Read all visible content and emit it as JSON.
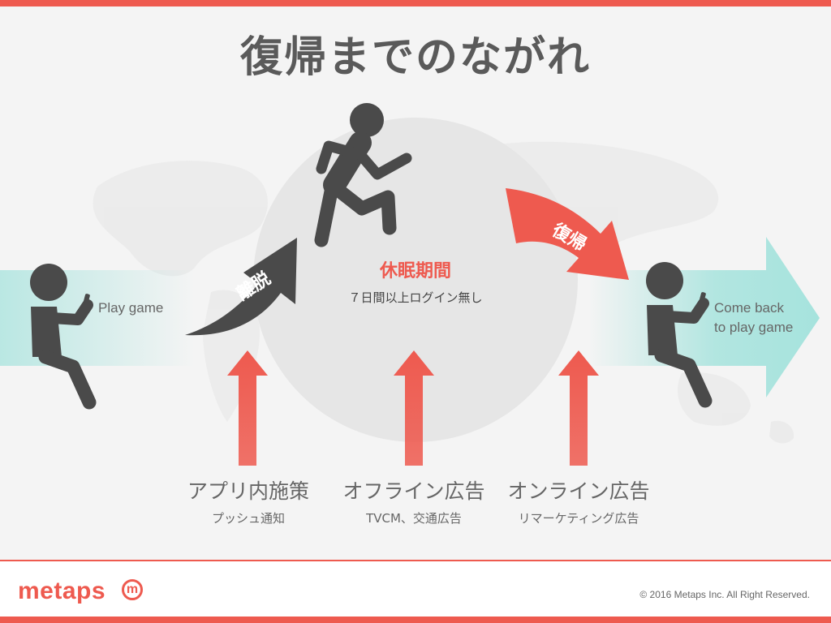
{
  "title": "復帰までのながれ",
  "colors": {
    "accent": "#ee5a4f",
    "figure": "#4a4a4a",
    "teal": "#a6e3dd",
    "circle": "#e6e6e6"
  },
  "flow": {
    "play_label": "Play game",
    "churn_label": "離脱",
    "dormant_title": "休眠期間",
    "dormant_sub": "７日間以上ログイン無し",
    "return_label": "復帰",
    "come_back_line1": "Come back",
    "come_back_line2": "to play game"
  },
  "measures": [
    {
      "title": "アプリ内施策",
      "sub": "プッシュ通知"
    },
    {
      "title": "オフライン広告",
      "sub": "TVCM、交通広告"
    },
    {
      "title": "オンライン広告",
      "sub": "リマーケティング広告"
    }
  ],
  "footer": {
    "logo_text": "metaps",
    "logo_mark": "m",
    "copyright": "© 2016 Metaps Inc. All Right Reserved."
  }
}
